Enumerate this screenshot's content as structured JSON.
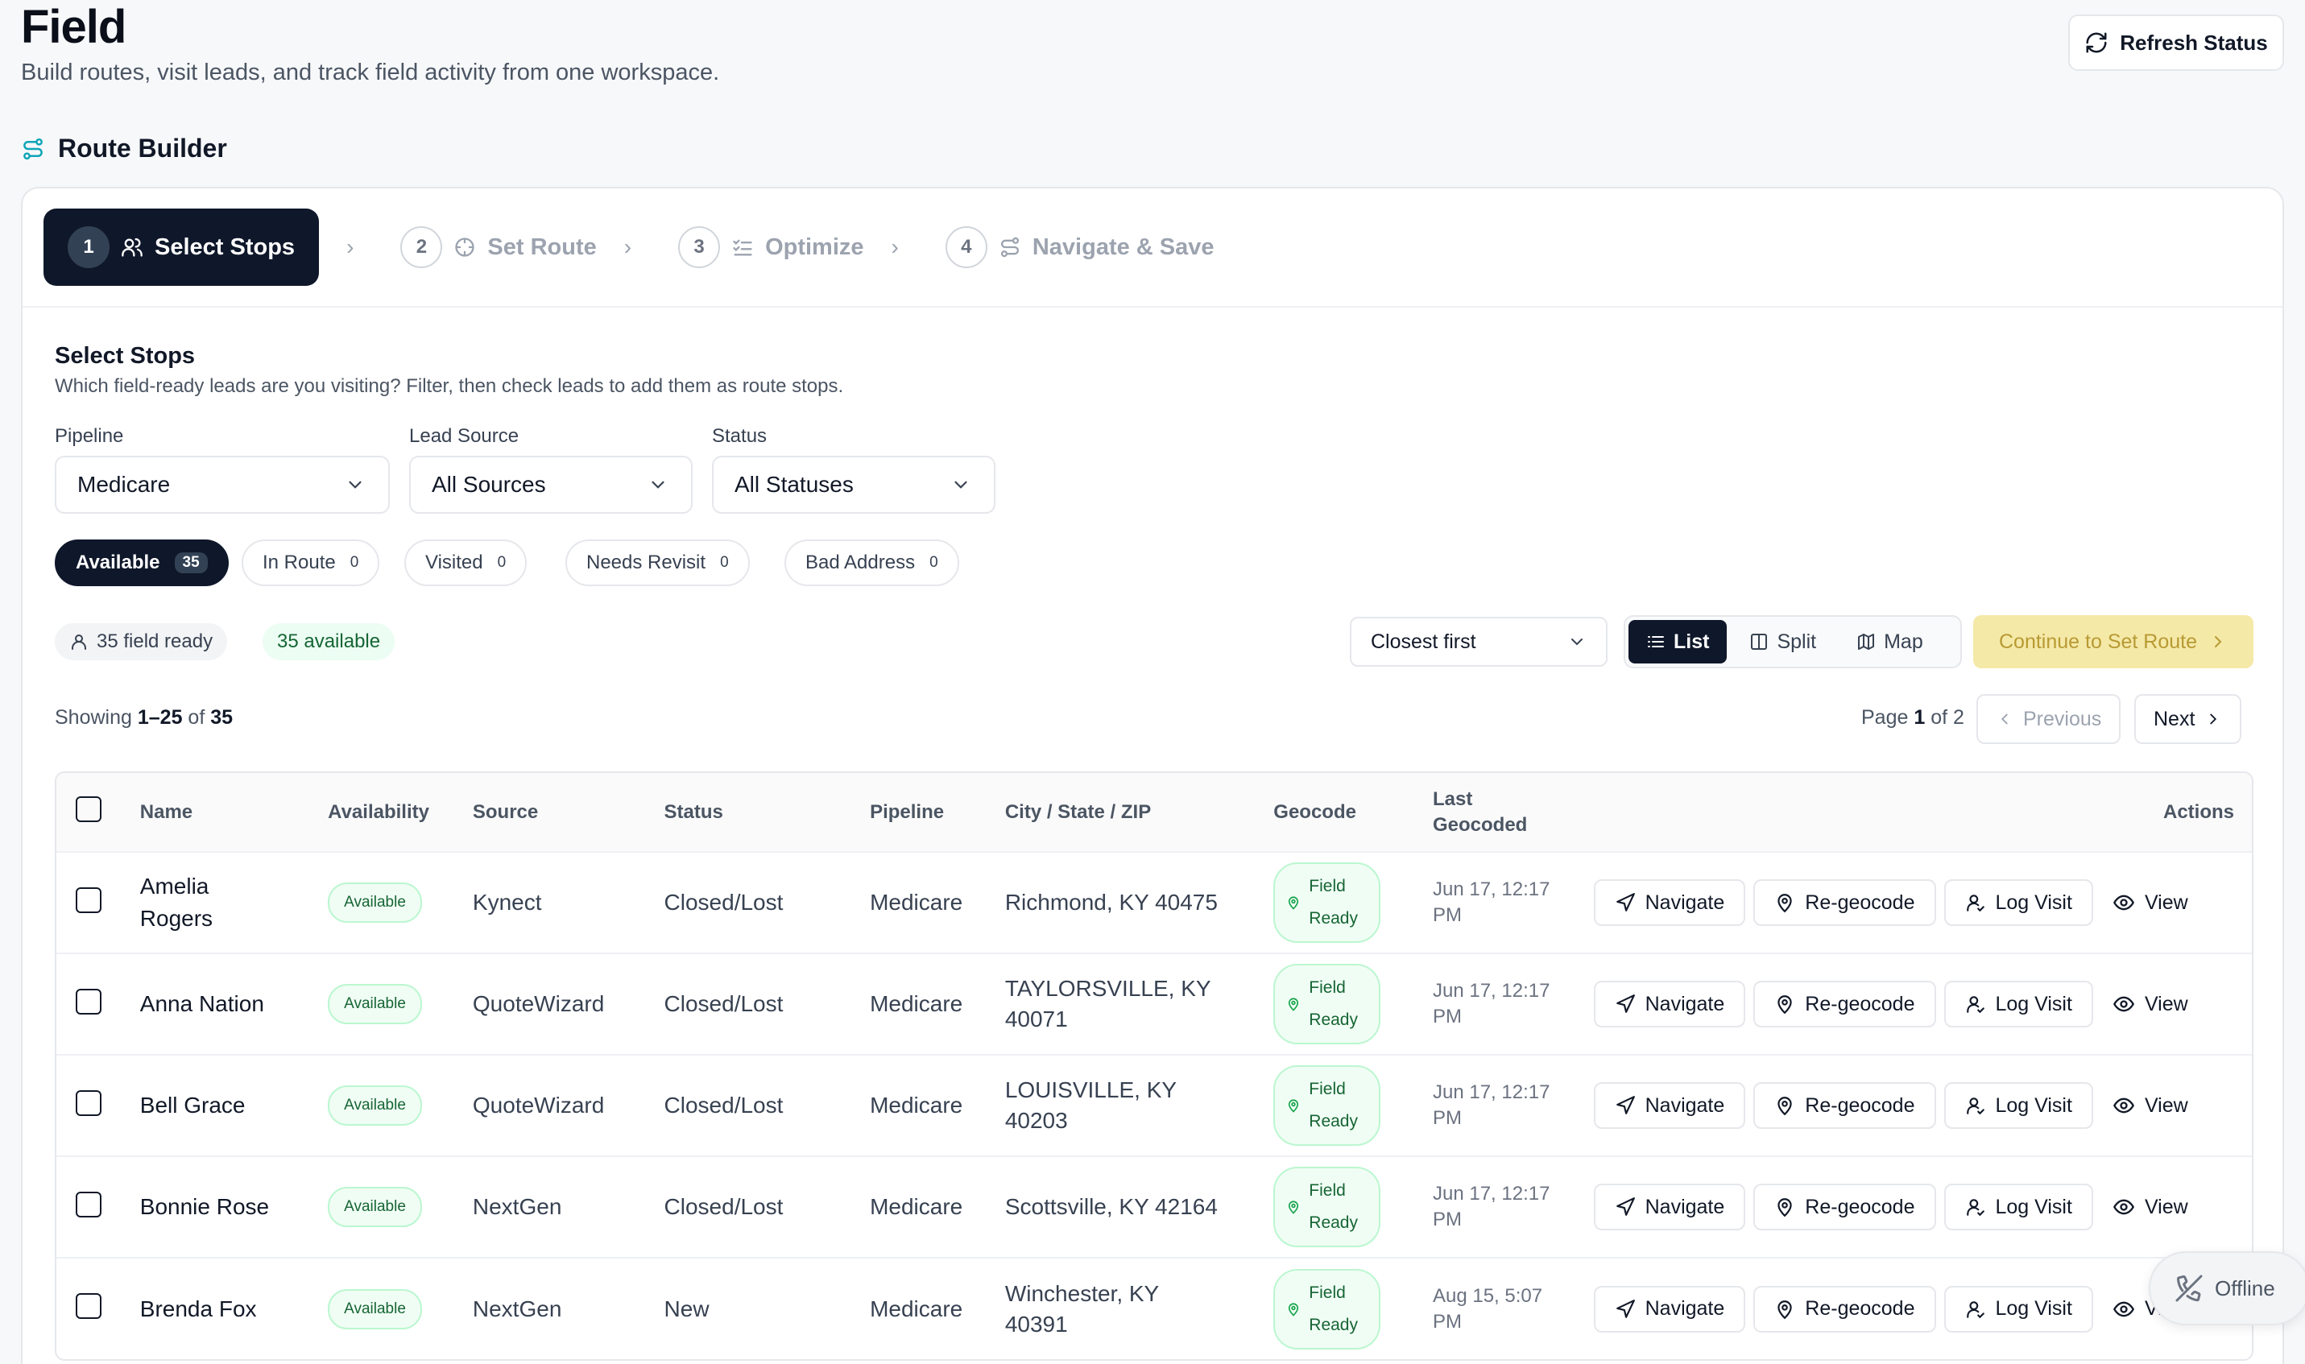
{
  "header": {
    "title": "Field",
    "subtitle": "Build routes, visit leads, and track field activity from one workspace.",
    "refresh_label": "Refresh Status"
  },
  "section": {
    "title": "Route Builder"
  },
  "stepper": [
    {
      "num": "1",
      "label": "Select Stops"
    },
    {
      "num": "2",
      "label": "Set Route"
    },
    {
      "num": "3",
      "label": "Optimize"
    },
    {
      "num": "4",
      "label": "Navigate & Save"
    }
  ],
  "select_stops": {
    "title": "Select Stops",
    "subtitle": "Which field-ready leads are you visiting? Filter, then check leads to add them as route stops."
  },
  "filters": {
    "pipeline": {
      "label": "Pipeline",
      "value": "Medicare"
    },
    "lead_source": {
      "label": "Lead Source",
      "value": "All Sources"
    },
    "status": {
      "label": "Status",
      "value": "All Statuses"
    }
  },
  "chips": [
    {
      "label": "Available",
      "count": "35"
    },
    {
      "label": "In Route",
      "count": "0"
    },
    {
      "label": "Visited",
      "count": "0"
    },
    {
      "label": "Needs Revisit",
      "count": "0"
    },
    {
      "label": "Bad Address",
      "count": "0"
    }
  ],
  "summary": {
    "field_ready": "35 field ready",
    "available": "35 available"
  },
  "sort": {
    "value": "Closest first"
  },
  "views": {
    "list": "List",
    "split": "Split",
    "map": "Map"
  },
  "continue_label": "Continue to Set Route",
  "pagination": {
    "showing_prefix": "Showing ",
    "range": "1–25",
    "of": " of ",
    "total": "35",
    "page_prefix": "Page ",
    "page": "1",
    "page_of": " of 2",
    "prev": "Previous",
    "next": "Next"
  },
  "table": {
    "headers": {
      "name": "Name",
      "availability": "Availability",
      "source": "Source",
      "status": "Status",
      "pipeline": "Pipeline",
      "city": "City / State / ZIP",
      "geocode": "Geocode",
      "last_geo_1": "Last",
      "last_geo_2": "Geocoded",
      "actions": "Actions"
    },
    "action_labels": {
      "navigate": "Navigate",
      "regeocode": "Re-geocode",
      "log_visit": "Log Visit",
      "view": "View"
    },
    "rows": [
      {
        "name_1": "Amelia",
        "name_2": "Rogers",
        "availability": "Available",
        "source": "Kynect",
        "status": "Closed/Lost",
        "pipeline": "Medicare",
        "city_1": "Richmond, KY 40475",
        "city_2": "",
        "geo_1": "Field",
        "geo_2": "Ready",
        "last_1": "Jun 17, 12:17",
        "last_2": "PM"
      },
      {
        "name_1": "Anna Nation",
        "name_2": "",
        "availability": "Available",
        "source": "QuoteWizard",
        "status": "Closed/Lost",
        "pipeline": "Medicare",
        "city_1": "TAYLORSVILLE, KY",
        "city_2": "40071",
        "geo_1": "Field",
        "geo_2": "Ready",
        "last_1": "Jun 17, 12:17",
        "last_2": "PM"
      },
      {
        "name_1": "Bell Grace",
        "name_2": "",
        "availability": "Available",
        "source": "QuoteWizard",
        "status": "Closed/Lost",
        "pipeline": "Medicare",
        "city_1": "LOUISVILLE, KY",
        "city_2": "40203",
        "geo_1": "Field",
        "geo_2": "Ready",
        "last_1": "Jun 17, 12:17",
        "last_2": "PM"
      },
      {
        "name_1": "Bonnie Rose",
        "name_2": "",
        "availability": "Available",
        "source": "NextGen",
        "status": "Closed/Lost",
        "pipeline": "Medicare",
        "city_1": "Scottsville, KY 42164",
        "city_2": "",
        "geo_1": "Field",
        "geo_2": "Ready",
        "last_1": "Jun 17, 12:17",
        "last_2": "PM"
      },
      {
        "name_1": "Brenda Fox",
        "name_2": "",
        "availability": "Available",
        "source": "NextGen",
        "status": "New",
        "pipeline": "Medicare",
        "city_1": "Winchester, KY",
        "city_2": "40391",
        "geo_1": "Field",
        "geo_2": "Ready",
        "last_1": "Aug 15, 5:07",
        "last_2": "PM"
      }
    ]
  },
  "offline_label": "Offline"
}
